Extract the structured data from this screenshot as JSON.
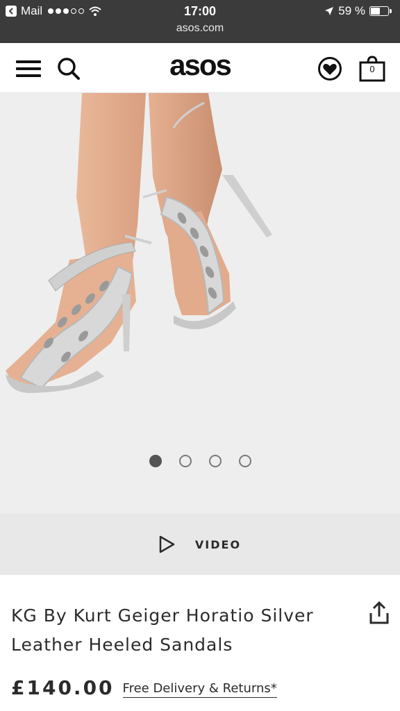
{
  "status_bar": {
    "back_app": "Mail",
    "time": "17:00",
    "url": "asos.com",
    "battery_percent": "59 %",
    "battery_level": 0.59,
    "signal_filled": 3,
    "signal_total": 5
  },
  "nav": {
    "logo": "asos",
    "bag_count": "0"
  },
  "gallery": {
    "image_count": 4,
    "active_index": 0
  },
  "video": {
    "label": "VIDEO"
  },
  "product": {
    "title_line1": "KG By Kurt Geiger Horatio Silver",
    "title_line2": "Leather Heeled Sandals",
    "price": "£140.00",
    "delivery_link": "Free Delivery & Returns*"
  },
  "icons": {
    "back": "back-arrow-icon",
    "signal": "signal-dots-icon",
    "wifi": "wifi-icon",
    "location": "location-arrow-icon",
    "battery": "battery-icon",
    "menu": "hamburger-menu-icon",
    "search": "search-icon",
    "saved": "heart-icon",
    "bag": "shopping-bag-icon",
    "play": "play-icon",
    "share": "share-icon"
  },
  "colors": {
    "status_bar": "#3b3b3b",
    "gallery_background": "#eeeeee",
    "video_bar": "#e8e8e8",
    "text": "#2b2b2b"
  }
}
